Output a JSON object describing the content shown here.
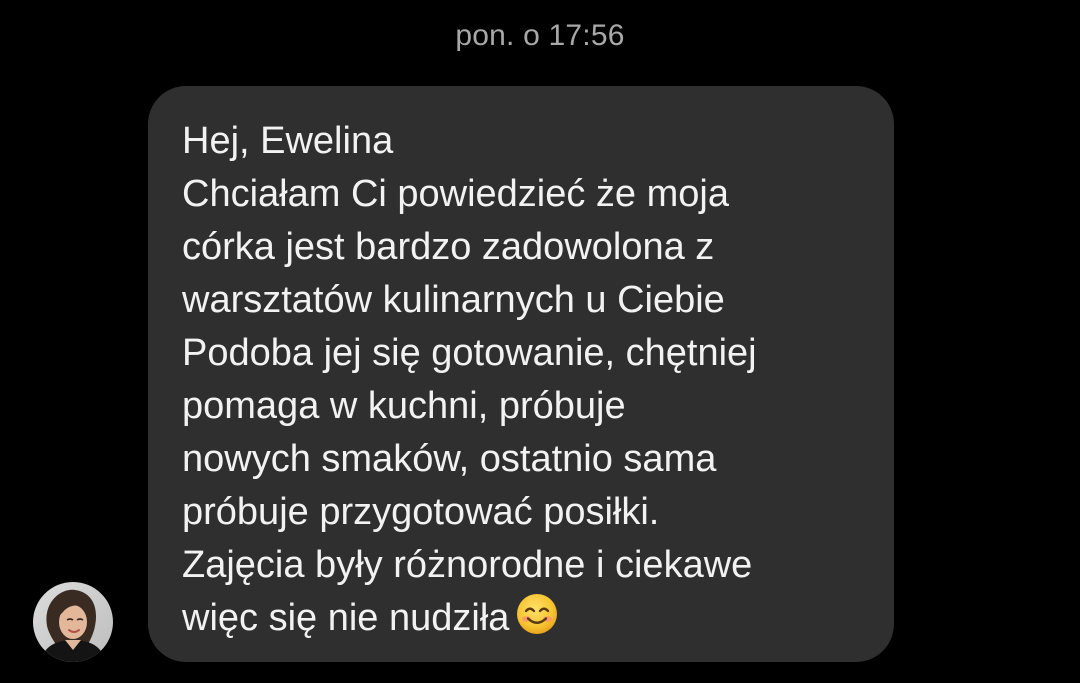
{
  "thread": {
    "timestamp": "pon. o 17:56"
  },
  "message": {
    "lines": [
      "Hej, Ewelina",
      "Chciałam Ci powiedzieć że moja",
      "córka jest bardzo zadowolona z",
      "warsztatów kulinarnych u Ciebie",
      "Podoba jej się gotowanie, chętniej",
      "pomaga w kuchni, próbuje",
      "nowych smaków, ostatnio sama",
      "próbuje przygotować posiłki.",
      "Zajęcia były różnorodne i ciekawe",
      "więc się nie nudziła"
    ],
    "emoji": "smiling-face-with-smiling-eyes-emoji"
  },
  "sender": {
    "avatar": "avatar-photo"
  },
  "colors": {
    "background": "#000000",
    "bubble": "#2f2f2f",
    "message_text": "#f2f2f2",
    "timestamp_text": "#a8a8a8",
    "emoji_face": "#f7c531"
  }
}
